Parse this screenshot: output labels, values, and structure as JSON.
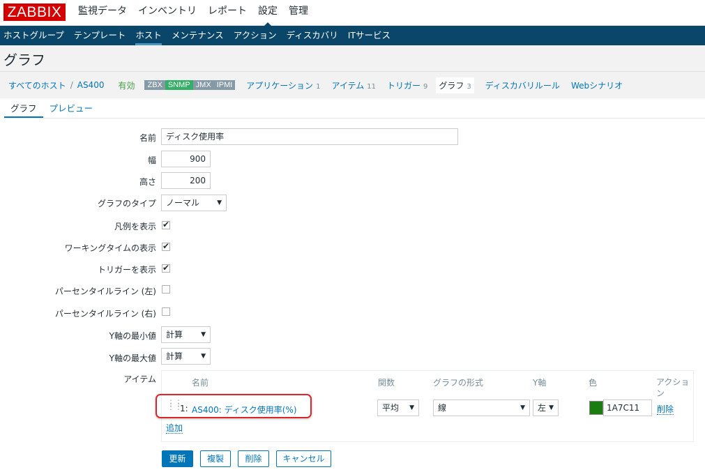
{
  "brand": {
    "logo_text": "ZABBIX",
    "logo_color": "#d40000"
  },
  "main_menu": [
    {
      "label": "監視データ"
    },
    {
      "label": "インベントリ"
    },
    {
      "label": "レポート"
    },
    {
      "label": "設定",
      "active": true
    },
    {
      "label": "管理"
    }
  ],
  "sub_menu": [
    {
      "label": "ホストグループ"
    },
    {
      "label": "テンプレート"
    },
    {
      "label": "ホスト",
      "active": true
    },
    {
      "label": "メンテナンス"
    },
    {
      "label": "アクション"
    },
    {
      "label": "ディスカバリ"
    },
    {
      "label": "ITサービス"
    }
  ],
  "page_title": "グラフ",
  "host_nav": {
    "all_hosts": "すべてのホスト",
    "separator": "/",
    "host": "AS400",
    "status": "有効",
    "availability": [
      "ZBX",
      "SNMP",
      "JMX",
      "IPMI"
    ],
    "links": [
      {
        "label": "アプリケーション",
        "count": "1"
      },
      {
        "label": "アイテム",
        "count": "11"
      },
      {
        "label": "トリガー",
        "count": "9"
      },
      {
        "label": "グラフ",
        "count": "3",
        "current": true
      },
      {
        "label": "ディスカバリルール",
        "count": ""
      },
      {
        "label": "Webシナリオ",
        "count": ""
      }
    ]
  },
  "tabs": {
    "graph": "グラフ",
    "preview": "プレビュー"
  },
  "form": {
    "name_label": "名前",
    "name_value": "ディスク使用率",
    "width_label": "幅",
    "width_value": "900",
    "height_label": "高さ",
    "height_value": "200",
    "graph_type_label": "グラフのタイプ",
    "graph_type_value": "ノーマル",
    "show_legend_label": "凡例を表示",
    "show_legend": true,
    "show_working_time_label": "ワーキングタイムの表示",
    "show_working_time": true,
    "show_triggers_label": "トリガーを表示",
    "show_triggers": true,
    "percentile_left_label": "パーセンタイルライン (左)",
    "percentile_left": false,
    "percentile_right_label": "パーセンタイルライン (右)",
    "percentile_right": false,
    "ymin_label": "Y軸の最小値",
    "ymin_value": "計算",
    "ymax_label": "Y軸の最大値",
    "ymax_value": "計算",
    "items_label": "アイテム"
  },
  "items_table": {
    "headers": {
      "name": "名前",
      "function": "関数",
      "draw_style": "グラフの形式",
      "y_axis": "Y軸",
      "color": "色",
      "action": "アクション"
    },
    "rows": [
      {
        "index": "1:",
        "name": "AS400: ディスク使用率(%)",
        "function": "平均",
        "draw_style": "線",
        "y_axis": "左",
        "color_hex": "1A7C11",
        "color": "#1a7c11",
        "remove": "削除"
      }
    ],
    "add": "追加"
  },
  "buttons": {
    "update": "更新",
    "clone": "複製",
    "delete": "削除",
    "cancel": "キャンセル"
  }
}
